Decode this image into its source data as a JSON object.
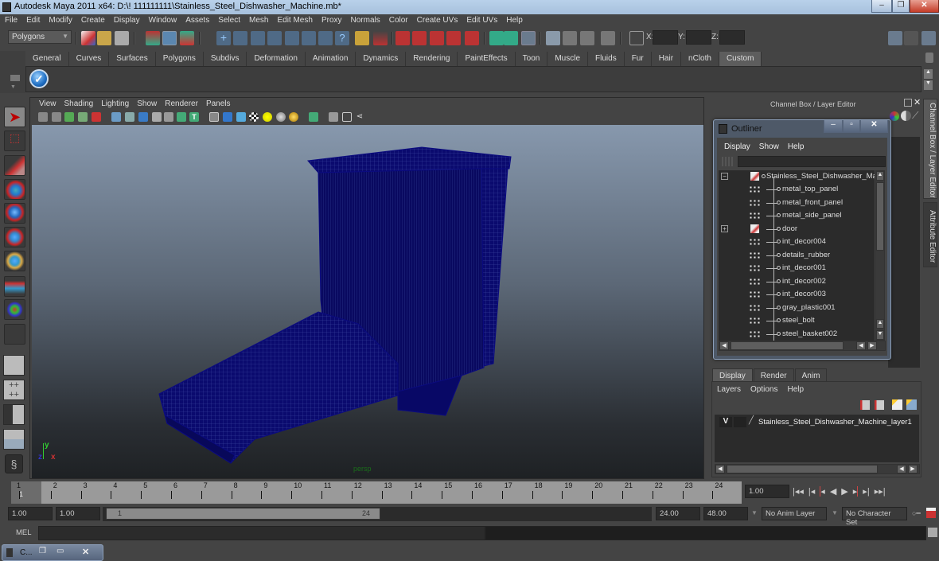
{
  "window": {
    "title": "Autodesk Maya 2011 x64: D:\\! 111111111\\Stainless_Steel_Dishwasher_Machine.mb*",
    "minimize_label": "–",
    "restore_label": "❐",
    "close_label": "✕"
  },
  "menubar": [
    "File",
    "Edit",
    "Modify",
    "Create",
    "Display",
    "Window",
    "Assets",
    "Select",
    "Mesh",
    "Edit Mesh",
    "Proxy",
    "Normals",
    "Color",
    "Create UVs",
    "Edit UVs",
    "Help"
  ],
  "statusline": {
    "menu_set": "Polygons",
    "x_label": "X:",
    "y_label": "Y:",
    "z_label": "Z:",
    "x_value": "",
    "y_value": "",
    "z_value": ""
  },
  "shelf": {
    "tabs": [
      "General",
      "Curves",
      "Surfaces",
      "Polygons",
      "Subdivs",
      "Deformation",
      "Animation",
      "Dynamics",
      "Rendering",
      "PaintEffects",
      "Toon",
      "Muscle",
      "Fluids",
      "Fur",
      "Hair",
      "nCloth",
      "Custom"
    ],
    "active_tab": "Custom"
  },
  "toolbox": [
    "select-tool",
    "lasso-tool",
    "paint-select-tool",
    "move-tool",
    "rotate-tool",
    "scale-tool",
    "universal-manipulator",
    "soft-modification-tool",
    "show-manipulator",
    "last-tool",
    "single-perspective-layout",
    "four-view-layout",
    "persp-outliner-layout",
    "persp-graph-layout",
    "hypergraph-layout"
  ],
  "viewport": {
    "menu": [
      "View",
      "Shading",
      "Lighting",
      "Show",
      "Renderer",
      "Panels"
    ],
    "camera_label": "persp",
    "axis_x": "x",
    "axis_y": "y",
    "axis_z": "z",
    "wire_color": "#0a0a78"
  },
  "channel_box": {
    "title": "Channel Box / Layer Editor",
    "side_tabs": [
      "Channel Box / Layer Editor",
      "Attribute Editor"
    ]
  },
  "outliner": {
    "title": "Outliner",
    "menu": [
      "Display",
      "Show",
      "Help"
    ],
    "filter_value": "",
    "items": [
      {
        "label": "Stainless_Steel_Dishwasher_Mach",
        "type": "group",
        "expand": "−",
        "root": true
      },
      {
        "label": "metal_top_panel",
        "type": "mesh"
      },
      {
        "label": "metal_front_panel",
        "type": "mesh"
      },
      {
        "label": "metal_side_panel",
        "type": "mesh"
      },
      {
        "label": "door",
        "type": "group",
        "expand": "+"
      },
      {
        "label": "int_decor004",
        "type": "mesh"
      },
      {
        "label": "details_rubber",
        "type": "mesh"
      },
      {
        "label": "int_decor001",
        "type": "mesh"
      },
      {
        "label": "int_decor002",
        "type": "mesh"
      },
      {
        "label": "int_decor003",
        "type": "mesh"
      },
      {
        "label": "gray_plastic001",
        "type": "mesh"
      },
      {
        "label": "steel_bolt",
        "type": "mesh"
      },
      {
        "label": "steel_basket002",
        "type": "mesh"
      }
    ]
  },
  "layer_editor": {
    "tabs": [
      "Display",
      "Render",
      "Anim"
    ],
    "active_tab": "Display",
    "menu": [
      "Layers",
      "Options",
      "Help"
    ],
    "layers": [
      {
        "visible": "V",
        "name": "Stainless_Steel_Dishwasher_Machine_layer1"
      }
    ]
  },
  "time_slider": {
    "ticks": [
      "1",
      "2",
      "3",
      "4",
      "5",
      "6",
      "7",
      "8",
      "9",
      "10",
      "11",
      "12",
      "13",
      "14",
      "15",
      "16",
      "17",
      "18",
      "19",
      "20",
      "21",
      "22",
      "23",
      "24"
    ],
    "current_frame_marker": "1",
    "current_time": "1.00"
  },
  "range_slider": {
    "start_time": "1.00",
    "playback_start": "1.00",
    "range_start_label": "1",
    "range_end_label": "24",
    "playback_end": "24.00",
    "end_time": "48.00",
    "anim_layer": "No Anim Layer",
    "character_set": "No Character Set"
  },
  "playback": [
    "go-to-start",
    "step-back-frame",
    "step-back-key",
    "play-backwards",
    "play-forwards",
    "step-forward-key",
    "step-forward-frame",
    "go-to-end"
  ],
  "command_line": {
    "label": "MEL",
    "value": "",
    "result": ""
  },
  "taskbar": {
    "minimized_window_label": "C..."
  }
}
